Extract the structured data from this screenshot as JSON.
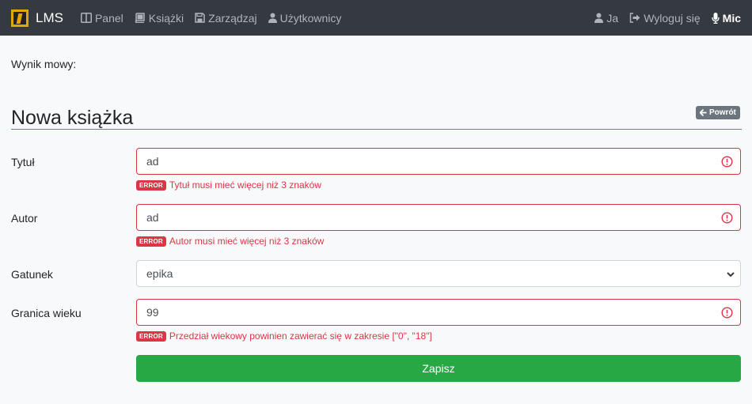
{
  "navbar": {
    "brand": "LMS",
    "items": [
      {
        "label": "Panel",
        "icon": "columns-icon"
      },
      {
        "label": "Książki",
        "icon": "book-icon"
      },
      {
        "label": "Zarządzaj",
        "icon": "save-icon"
      },
      {
        "label": "Użytkownicy",
        "icon": "user-icon"
      }
    ],
    "right": [
      {
        "label": "Ja",
        "icon": "user-icon"
      },
      {
        "label": "Wyloguj się",
        "icon": "sign-out-icon"
      },
      {
        "label": "Mic",
        "icon": "microphone-icon"
      }
    ]
  },
  "speech_result": "Wynik mowy:",
  "page": {
    "title": "Nowa książka",
    "back_label": "Powrót"
  },
  "form": {
    "title": {
      "label": "Tytuł",
      "value": "ad",
      "error_badge": "ERROR",
      "error": "Tytuł musi mieć więcej niż 3 znaków"
    },
    "author": {
      "label": "Autor",
      "value": "ad",
      "error_badge": "ERROR",
      "error": "Autor musi mieć więcej niż 3 znaków"
    },
    "genre": {
      "label": "Gatunek",
      "value": "epika"
    },
    "age_limit": {
      "label": "Granica wieku",
      "value": "99",
      "error_badge": "ERROR",
      "error": "Przedział wiekowy powinien zawierać się w zakresie [\"0\", \"18\"]"
    },
    "submit_label": "Zapisz"
  },
  "colors": {
    "navbar": "#343a40",
    "accent_rule": "#17a2b8",
    "danger": "#dc3545",
    "success": "#28a745",
    "secondary": "#6c757d"
  }
}
